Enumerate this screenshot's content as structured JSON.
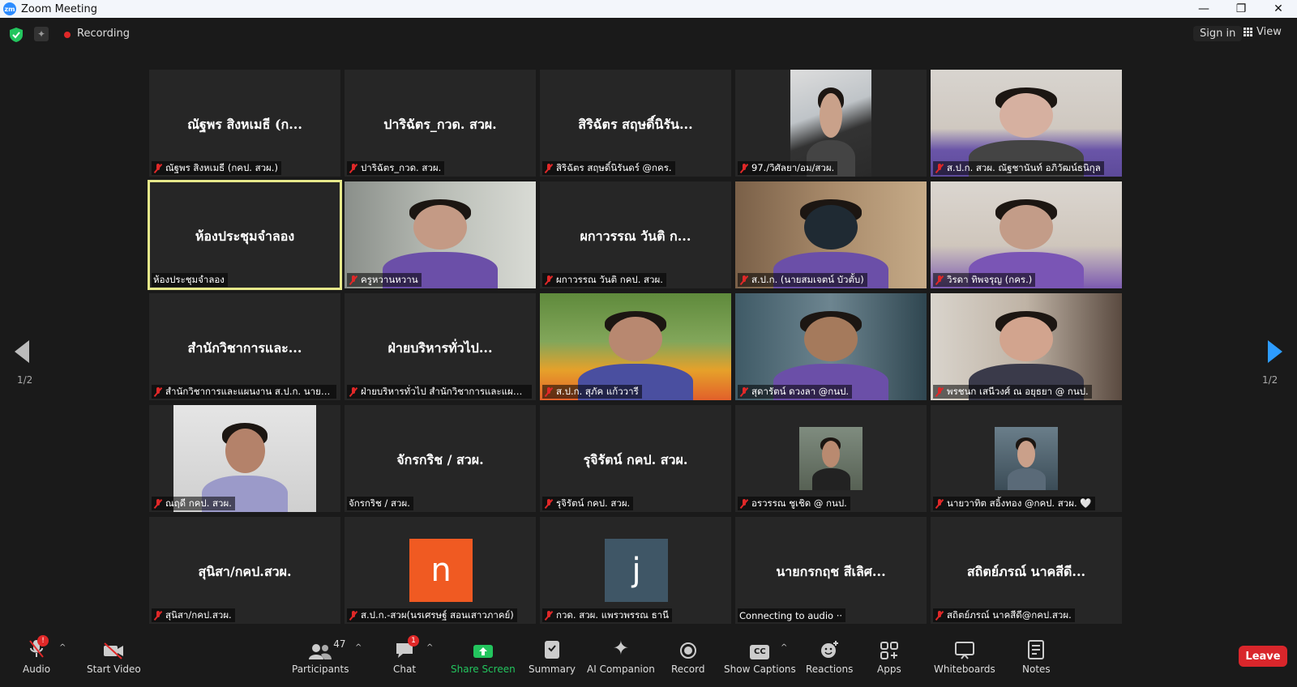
{
  "window": {
    "title": "Zoom Meeting",
    "logo": "zm",
    "minimize": "—",
    "maximize": "❐",
    "close": "✕"
  },
  "topbar": {
    "recording": "Recording",
    "sign_in": "Sign in",
    "view": "View"
  },
  "pager": {
    "left": "1/2",
    "right": "1/2"
  },
  "tiles": [
    {
      "name": "ณัฐพร สิงหเมธี (ก...",
      "label": "ณัฐพร สิงหเมธี (กคป. สวผ.)",
      "muted": true,
      "kind": "name"
    },
    {
      "name": "ปาริฉัตร_กวด. สวผ.",
      "label": "ปาริฉัตร_กวด. สวผ.",
      "muted": true,
      "kind": "name"
    },
    {
      "name": "สิริฉัตร สฤษดิ์นิรัน...",
      "label": "สิริฉัตร สฤษดิ์นิรันดร์ @กคร.",
      "muted": true,
      "kind": "name"
    },
    {
      "label": "97./วิศัลยา/อม/สวผ.",
      "muted": true,
      "kind": "video"
    },
    {
      "label": "ส.ป.ก. สวผ. ณัฐชานันท์ อภิวัฒน์ธนิกุล",
      "muted": true,
      "kind": "video"
    },
    {
      "name": "ห้องประชุมจำลอง",
      "label": "ห้องประชุมจำลอง",
      "muted": false,
      "kind": "name",
      "active": true
    },
    {
      "label": "ครูหวานหวาน",
      "muted": true,
      "kind": "video"
    },
    {
      "name": "ผกาวรรณ วันติ ก...",
      "label": "ผกาวรรณ วันติ กคป. สวผ.",
      "muted": true,
      "kind": "name"
    },
    {
      "label": "ส.ป.ก. (นายสมเจตน์ บัวตั้บ)",
      "muted": true,
      "kind": "video"
    },
    {
      "label": "วิรดา ทิพจรุญ (กคร.)",
      "muted": true,
      "kind": "video"
    },
    {
      "name": "สำนักวิชาการและ...",
      "label": "สำนักวิชาการและแผนงาน ส.ป.ก. นายอุกฤ...",
      "muted": true,
      "kind": "name"
    },
    {
      "name": "ฝ่ายบริหารทั่วไป...",
      "label": "ฝ่ายบริหารทั่วไป สำนักวิชาการและแผนงาน",
      "muted": true,
      "kind": "name"
    },
    {
      "label": "ส.ป.ก. สุภัค แก้ววารี",
      "muted": true,
      "kind": "video"
    },
    {
      "label": "สุดารัตน์ ดวงลา @กนป.",
      "muted": true,
      "kind": "video"
    },
    {
      "label": "พรชนก เสนีวงศ์ ณ อยุธยา @ กนป.",
      "muted": true,
      "kind": "video"
    },
    {
      "label": "ณฤดี กคป. สวผ.",
      "muted": true,
      "kind": "video"
    },
    {
      "name": "จักรกริช  / สวผ.",
      "label": "จักรกริช  / สวผ.",
      "muted": false,
      "kind": "name"
    },
    {
      "name": "รุจิรัตน์ กคป. สวผ.",
      "label": "รุจิรัตน์ กคป. สวผ.",
      "muted": true,
      "kind": "name"
    },
    {
      "label": "อรวรรณ ชูเชิด @ กนป.",
      "muted": true,
      "kind": "video"
    },
    {
      "label": "นายวาทิต สอิ้งทอง @กคป. สวผ. 🤍",
      "muted": true,
      "kind": "video"
    },
    {
      "name": "สุนิสา/กคป.สวผ.",
      "label": "สุนิสา/กคป.สวผ.",
      "muted": true,
      "kind": "name"
    },
    {
      "letter": "n",
      "label": "ส.ป.ก.-สวผ(นรเศรษฐ์ สอนเสาวภาคย์)",
      "muted": true,
      "kind": "letter",
      "color": "#f05a22"
    },
    {
      "letter": "j",
      "label": "กวด. สวผ. แพรวพรรณ ธานี",
      "muted": true,
      "kind": "letter",
      "color": "#3f5666"
    },
    {
      "name": "นายกรกฤช สีเลิศ...",
      "label": "Connecting to audio ··",
      "muted": false,
      "kind": "name"
    },
    {
      "name": "สถิตย์ภรณ์ นาคสีดี...",
      "label": "สถิตย์ภรณ์ นาคสีดี@กคป.สวผ.",
      "muted": true,
      "kind": "name"
    }
  ],
  "toolbar": {
    "audio": "Audio",
    "audio_badge": "!",
    "start_video": "Start Video",
    "participants": "Participants",
    "participant_count": "47",
    "chat": "Chat",
    "chat_badge": "1",
    "share_screen": "Share Screen",
    "summary": "Summary",
    "ai_companion": "AI Companion",
    "record": "Record",
    "show_captions": "Show Captions",
    "captions_icon": "CC",
    "reactions": "Reactions",
    "apps": "Apps",
    "whiteboards": "Whiteboards",
    "notes": "Notes",
    "leave": "Leave"
  },
  "colors": {
    "accent": "#2d8cff",
    "active_border": "#e6e88a",
    "leave": "#d9262b",
    "share": "#23c55e",
    "mute": "#e02828"
  }
}
